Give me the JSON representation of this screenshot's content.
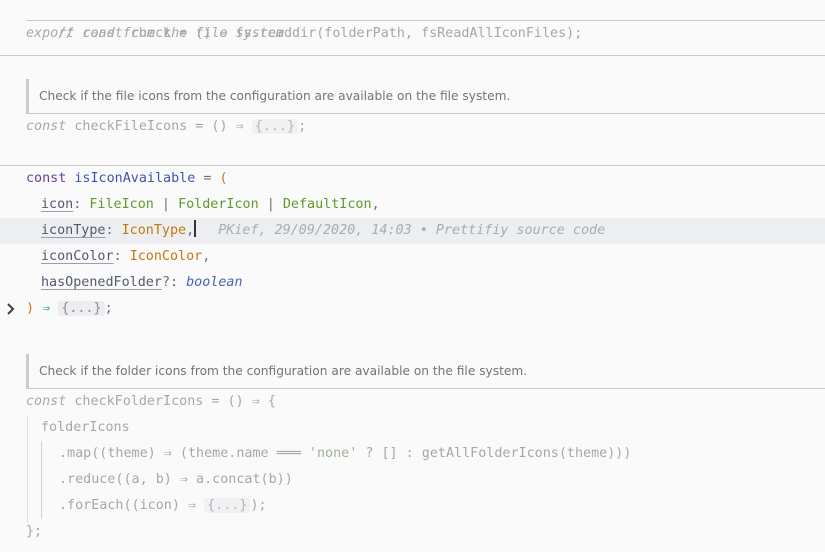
{
  "lines": {
    "l1_comment": "// read from the file system",
    "l2_export": "export",
    "l2_const": "const",
    "l2_rest": " check = () ⇒ fs.readdir(folderPath, fsReadAllIconFiles);",
    "doc1": "Check if the file icons from the configuration are available on the file system.",
    "l3_const": "const",
    "l3_rest": " checkFileIcons = () ⇒ ",
    "l3_fold": "{...}",
    "l3_end": ";",
    "l4_const": "const",
    "l4_name": " isIconAvailable",
    "l4_eq": " = ",
    "l4_paren": "(",
    "l5_param": "icon",
    "l5_colon": ": ",
    "l5_t1": "FileIcon",
    "l5_sep1": " | ",
    "l5_t2": "FolderIcon",
    "l5_sep2": " | ",
    "l5_t3": "DefaultIcon",
    "l5_end": ",",
    "l6_param": "iconType",
    "l6_colon": ": ",
    "l6_type": "IconType",
    "l6_end": ",",
    "l6_blame": "PKief, 29/09/2020, 14:03 • Prettifiy source code",
    "l7_param": "iconColor",
    "l7_colon": ": ",
    "l7_type": "IconColor",
    "l7_end": ",",
    "l8_param": "hasOpenedFolder",
    "l8_colon": "?: ",
    "l8_type": "boolean",
    "l9_paren": ")",
    "l9_arrow": " ⇒ ",
    "l9_fold": "{...}",
    "l9_end": ";",
    "doc2": "Check if the folder icons from the configuration are available on the file system.",
    "l10_const": "const",
    "l10_rest": " checkFolderIcons = () ⇒ {",
    "l11": "folderIcons",
    "l12_a": ".map((theme) ⇒ (theme.name ",
    "l12_eq": "═══",
    "l12_str": " 'none'",
    "l12_b": " ? [] : getAllFolderIcons(theme)))",
    "l13": ".reduce((a, b) ⇒ a.concat(b))",
    "l14_a": ".forEach((icon) ⇒ ",
    "l14_fold": "{...}",
    "l14_b": ");",
    "l15": "};"
  },
  "colors": {
    "background": "#fafafa",
    "keyword": "#7a3aa8",
    "type_green": "#5f9b2b",
    "type_orange": "#c2780b",
    "operator": "#0fa3a3"
  },
  "icons": {
    "fold_chevron": "chevron-right-icon"
  }
}
